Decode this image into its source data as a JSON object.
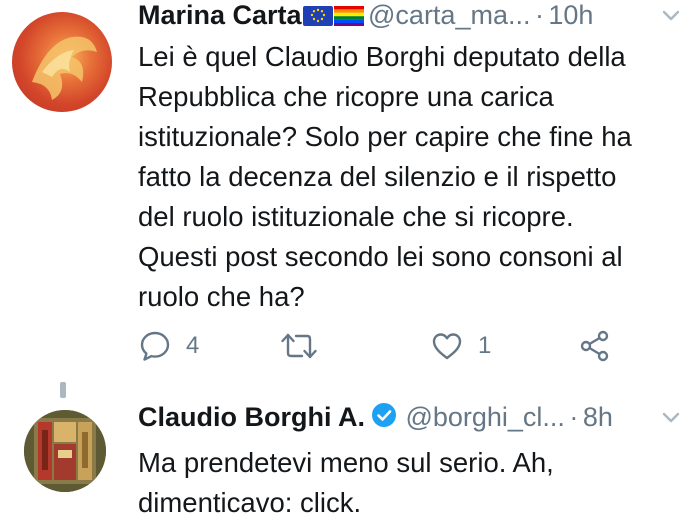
{
  "tweets": [
    {
      "display_name": "Marina Carta",
      "handle": "@carta_ma...",
      "separator": "·",
      "time": "10h",
      "text_lines": [
        "Lei è quel Claudio Borghi deputato della",
        "Repubblica che ricopre una carica",
        "istituzionale? Solo per capire che fine ha",
        "fatto la decenza del silenzio e il rispetto",
        "del ruolo istituzionale che si ricopre.",
        "Questi post secondo lei sono consoni al",
        "ruolo che ha?"
      ],
      "reply_count": "4",
      "like_count": "1",
      "name_emojis": [
        "eu-flag-icon",
        "rainbow-flag-icon"
      ]
    },
    {
      "display_name": "Claudio Borghi A.",
      "handle": "@borghi_cl...",
      "separator": "·",
      "time": "8h",
      "verified": true,
      "text_lines": [
        "Ma prendetevi meno sul serio. Ah,",
        "dimenticavo: click."
      ]
    }
  ],
  "colors": {
    "text": "#14171a",
    "secondary": "#657786",
    "verified": "#1da1f2"
  }
}
